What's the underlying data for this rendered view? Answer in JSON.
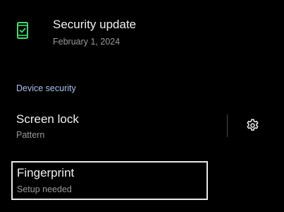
{
  "security_update": {
    "icon": "phone-check-icon",
    "title": "Security update",
    "date": "February 1, 2024"
  },
  "device_security": {
    "header": "Device security",
    "screen_lock": {
      "title": "Screen lock",
      "subtitle": "Pattern",
      "settings_icon": "gear-icon"
    },
    "fingerprint": {
      "title": "Fingerprint",
      "subtitle": "Setup needed"
    }
  },
  "colors": {
    "background": "#000000",
    "accent_green": "#3ddc6a",
    "section_header": "#a8c1f0",
    "primary_text": "#f1f1f1",
    "secondary_text": "#9a9a9a",
    "focus_border": "#e8e8e8"
  }
}
